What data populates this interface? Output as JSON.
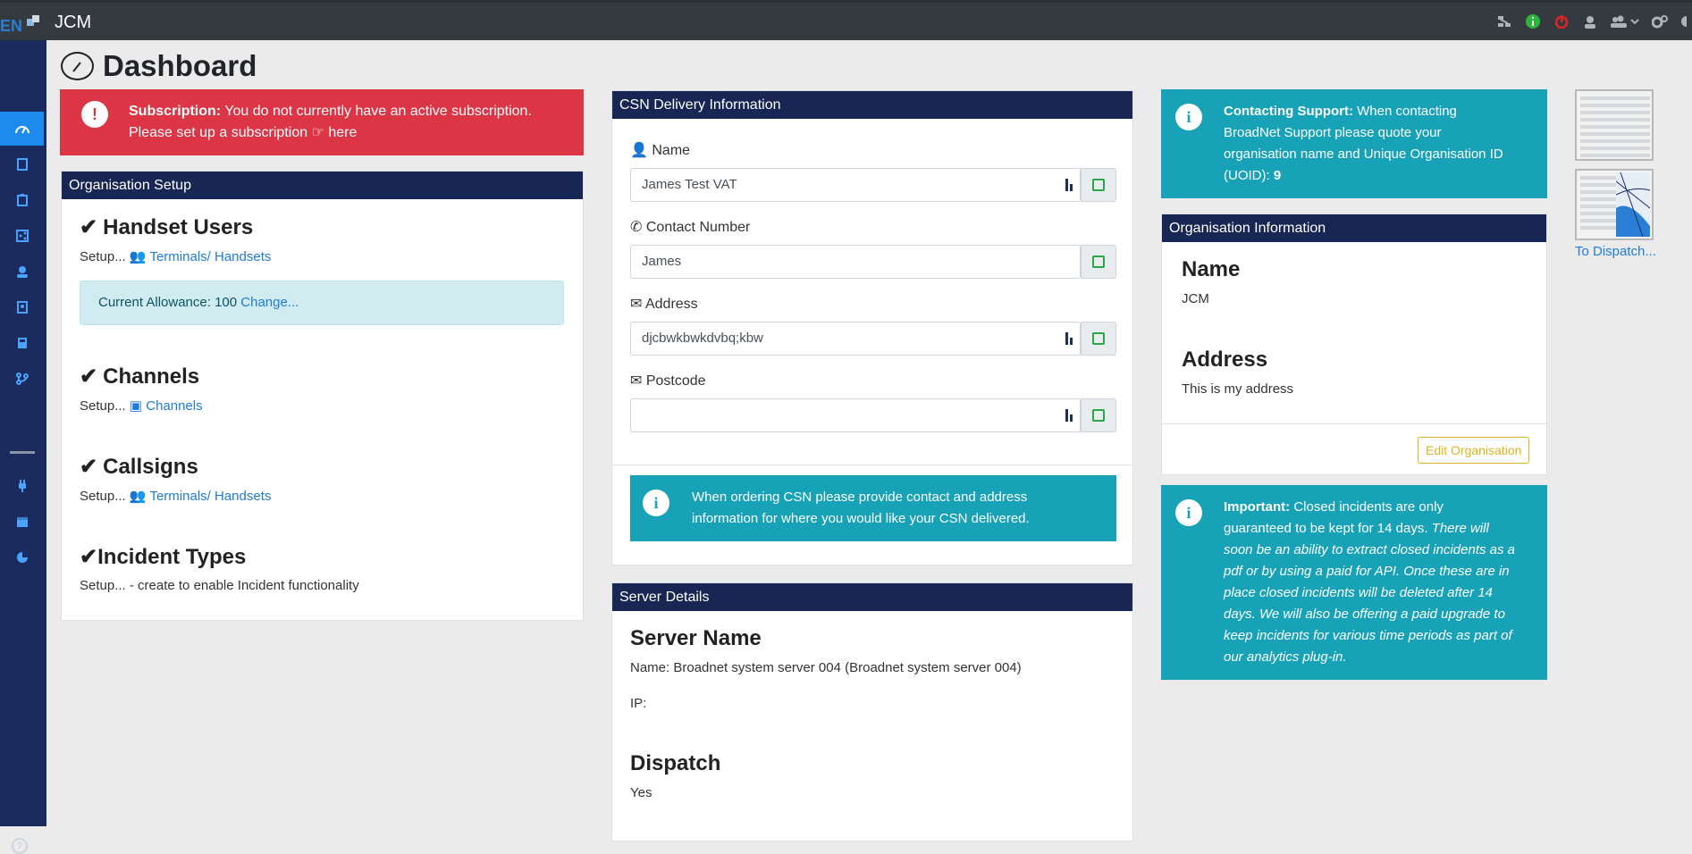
{
  "app": {
    "brand_title": "JCM",
    "page_title": "Dashboard"
  },
  "topbar_icons": [
    "network-icon",
    "info-icon",
    "power-icon",
    "user-secret-icon",
    "users-icon",
    "chevron-down-icon",
    "cogs-icon"
  ],
  "sidebar_icons": [
    "dashboard-icon",
    "file-icon",
    "clipboard-icon",
    "share-icon",
    "user-tie-icon",
    "address-book-icon",
    "calculator-icon",
    "code-branch-icon",
    "plug-icon",
    "calendar-icon",
    "chart-pie-icon"
  ],
  "subscription_alert": {
    "strong": "Subscription:",
    "line1": " You do not currently have an active subscription.",
    "line2": "Please set up a subscription",
    "link": "here"
  },
  "org_setup": {
    "header": "Organisation Setup",
    "handset_title": "Handset Users",
    "handset_setup": "Setup...",
    "handset_link": "Terminals/ Handsets",
    "allowance_text": "Current Allowance: 100",
    "allowance_link": "Change...",
    "channels_title": "Channels",
    "channels_setup": "Setup...",
    "channels_link": "Channels",
    "callsigns_title": "Callsigns",
    "callsigns_setup": "Setup...",
    "callsigns_link": "Terminals/ Handsets",
    "incident_title": "Incident Types",
    "incident_setup": "Setup... - create to enable Incident functionality"
  },
  "csn": {
    "header": "CSN Delivery Information",
    "name_label": "Name",
    "name_value": "James Test VAT",
    "contact_label": "Contact Number",
    "contact_value": "James",
    "address_label": "Address",
    "address_value": "djcbwkbwkdvbq;kbw",
    "postcode_label": "Postcode",
    "postcode_value": "",
    "info_line1": "When ordering CSN please provide contact and address",
    "info_line2": "information for where you would like your CSN delivered."
  },
  "server": {
    "header": "Server Details",
    "server_name_title": "Server Name",
    "server_name_value": "Name: Broadnet system server 004 (Broadnet system server 004)",
    "ip_label": "IP:",
    "dispatch_title": "Dispatch",
    "dispatch_value": "Yes"
  },
  "support_alert": {
    "strong": "Contacting Support:",
    "line1": " When contacting",
    "line2": "BroadNet Support please quote your",
    "line3": "organisation name and Unique Organisation ID",
    "line4": "(UOID):",
    "uoid": "9"
  },
  "org_info": {
    "header": "Organisation Information",
    "name_title": "Name",
    "name_value": "JCM",
    "address_title": "Address",
    "address_value": "This is my address",
    "edit_button": "Edit Organisation"
  },
  "important_alert": {
    "strong": "Important:",
    "line1": " Closed incidents are only",
    "line2": "guaranteed to be kept for 14 days.",
    "italic1": " There will",
    "line3": "soon be an ability to extract closed incidents as a",
    "line4": "pdf or by using a paid for API. Once these are in",
    "line5": "place closed incidents will be deleted after 14",
    "line6": "days. We will also be offering a paid upgrade to",
    "line7": "keep incidents for various time periods as part of",
    "line8": "our analytics plug-in."
  },
  "dispatch_link": "To Dispatch..."
}
